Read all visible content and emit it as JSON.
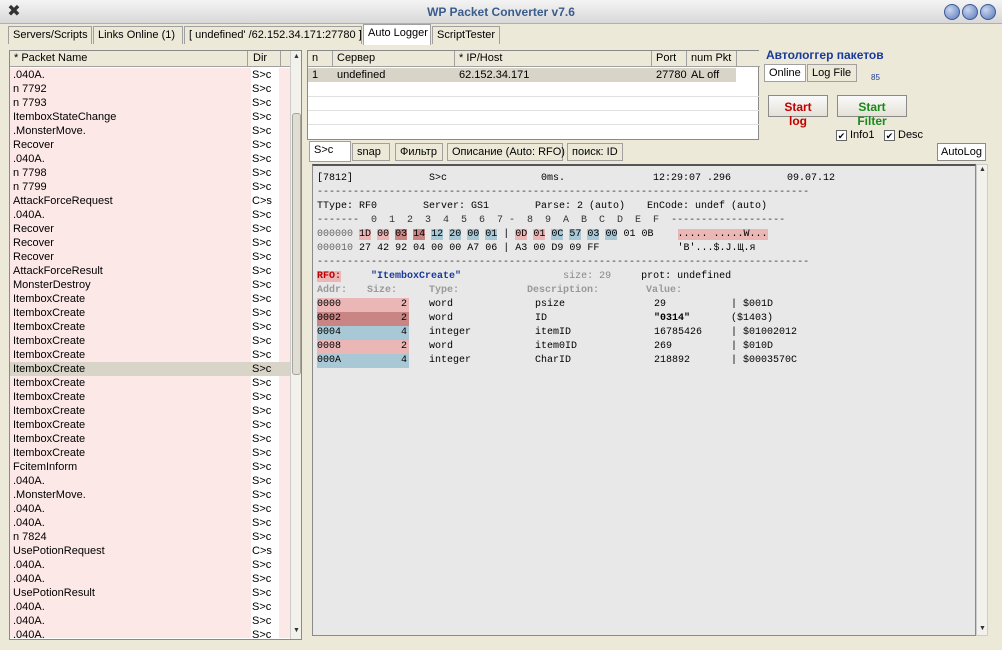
{
  "window": {
    "title": "WP Packet Converter v7.6"
  },
  "top_tabs": [
    {
      "label": "Servers/Scripts"
    },
    {
      "label": "Links Online (1)"
    },
    {
      "label": "[ undefined' /62.152.34.171:27780 ]"
    },
    {
      "label": "Auto Logger"
    },
    {
      "label": "ScriptTester"
    }
  ],
  "packet_list": {
    "headers": {
      "name": "* Packet Name",
      "dir": "Dir"
    },
    "rows": [
      {
        "name": ".040A.",
        "dir": "S>c"
      },
      {
        "name": "n 7792",
        "dir": "S>c"
      },
      {
        "name": "n 7793",
        "dir": "S>c"
      },
      {
        "name": "ItemboxStateChange",
        "dir": "S>c"
      },
      {
        "name": ".MonsterMove.",
        "dir": "S>c"
      },
      {
        "name": "Recover",
        "dir": "S>c"
      },
      {
        "name": ".040A.",
        "dir": "S>c"
      },
      {
        "name": "n 7798",
        "dir": "S>c"
      },
      {
        "name": "n 7799",
        "dir": "S>c"
      },
      {
        "name": "AttackForceRequest",
        "dir": "C>s"
      },
      {
        "name": ".040A.",
        "dir": "S>c"
      },
      {
        "name": "Recover",
        "dir": "S>c"
      },
      {
        "name": "Recover",
        "dir": "S>c"
      },
      {
        "name": "Recover",
        "dir": "S>c"
      },
      {
        "name": "AttackForceResult",
        "dir": "S>c"
      },
      {
        "name": "MonsterDestroy",
        "dir": "S>c"
      },
      {
        "name": "ItemboxCreate",
        "dir": "S>c"
      },
      {
        "name": "ItemboxCreate",
        "dir": "S>c"
      },
      {
        "name": "ItemboxCreate",
        "dir": "S>c"
      },
      {
        "name": "ItemboxCreate",
        "dir": "S>c"
      },
      {
        "name": "ItemboxCreate",
        "dir": "S>c"
      },
      {
        "name": "ItemboxCreate",
        "dir": "S>c",
        "selected": true
      },
      {
        "name": "ItemboxCreate",
        "dir": "S>c"
      },
      {
        "name": "ItemboxCreate",
        "dir": "S>c"
      },
      {
        "name": "ItemboxCreate",
        "dir": "S>c"
      },
      {
        "name": "ItemboxCreate",
        "dir": "S>c"
      },
      {
        "name": "ItemboxCreate",
        "dir": "S>c"
      },
      {
        "name": "ItemboxCreate",
        "dir": "S>c"
      },
      {
        "name": "FcitemInform",
        "dir": "S>c"
      },
      {
        "name": ".040A.",
        "dir": "S>c"
      },
      {
        "name": ".MonsterMove.",
        "dir": "S>c"
      },
      {
        "name": ".040A.",
        "dir": "S>c"
      },
      {
        "name": ".040A.",
        "dir": "S>c"
      },
      {
        "name": "n 7824",
        "dir": "S>c"
      },
      {
        "name": "UsePotionRequest",
        "dir": "C>s"
      },
      {
        "name": ".040A.",
        "dir": "S>c"
      },
      {
        "name": ".040A.",
        "dir": "S>c"
      },
      {
        "name": "UsePotionResult",
        "dir": "S>c"
      },
      {
        "name": ".040A.",
        "dir": "S>c"
      },
      {
        "name": ".040A.",
        "dir": "S>c"
      },
      {
        "name": ".040A.",
        "dir": "S>c"
      }
    ]
  },
  "connections": {
    "headers": {
      "n": "n",
      "server": "Сервер",
      "ip": "* IP/Host",
      "port": "Port",
      "num": "num Pkt"
    },
    "row": {
      "n": "1",
      "server": "undefined",
      "ip": "62.152.34.171",
      "port": "27780",
      "num": "AL off"
    }
  },
  "autolog": {
    "title": "Автологгер пакетов",
    "tab_online": "Online",
    "tab_logfile": "Log File",
    "counter": "85",
    "start_log": "Start log",
    "start_filter": "Start Filter",
    "info1": "Info1",
    "desc": "Desc",
    "autolog_button": "AutoLog"
  },
  "sub_tabs": [
    {
      "label": "S>c"
    },
    {
      "label": "snap"
    },
    {
      "label": "Фильтр"
    },
    {
      "label": "Описание (Auto: RFO)"
    },
    {
      "label": "поиск: ID"
    }
  ],
  "detail": {
    "header": {
      "id": "[7812]",
      "dir": "S>c",
      "ms": "0ms.",
      "time": "12:29:07 .296",
      "date": "09.07.12"
    },
    "info": {
      "ttype": "TType: RF0",
      "server": "Server: GS1",
      "parse": "Parse: 2 (auto)",
      "encode": "EnCode: undef (auto)"
    },
    "hex_header": "-------  0  1  2  3  4  5  6  7 -  8  9  A  B  C  D  E  F",
    "hex_rows": [
      {
        "addr": "000000",
        "bytes1": [
          "1D",
          "00",
          "03",
          "14",
          "12",
          "20",
          "00",
          "01"
        ],
        "bytes2": [
          "0D",
          "01",
          "0C",
          "57",
          "03",
          "00",
          "01",
          "0B"
        ],
        "ascii": "..... .....W..."
      },
      {
        "addr": "000010",
        "bytes1": [
          "27",
          "42",
          "92",
          "04",
          "00",
          "00",
          "A7",
          "06"
        ],
        "bytes2": [
          "A3",
          "00",
          "D9",
          "09",
          "FF"
        ],
        "ascii": "'B'...$.J.Щ.я"
      }
    ],
    "struct": {
      "tag": "RFO:",
      "name": "\"ItemboxCreate\"",
      "size": "size: 29",
      "prot": "prot: undefined"
    },
    "columns": {
      "addr": "Addr:",
      "size": "Size:",
      "type": "Type:",
      "desc": "Description:",
      "value": "Value:"
    },
    "fields": [
      {
        "addr": "0000",
        "size": "2",
        "type": "word",
        "desc": "psize",
        "value": "29",
        "hex": "| $001D"
      },
      {
        "addr": "0002",
        "size": "2",
        "type": "word",
        "desc": "ID",
        "value": "\"0314\"",
        "hex": "($1403)"
      },
      {
        "addr": "0004",
        "size": "4",
        "type": "integer",
        "desc": "itemID",
        "value": "16785426",
        "hex": "| $01002012"
      },
      {
        "addr": "0008",
        "size": "2",
        "type": "word",
        "desc": "item0ID",
        "value": "269",
        "hex": "| $010D"
      },
      {
        "addr": "000A",
        "size": "4",
        "type": "integer",
        "desc": "CharID",
        "value": "218892",
        "hex": "| $0003570C"
      }
    ]
  }
}
